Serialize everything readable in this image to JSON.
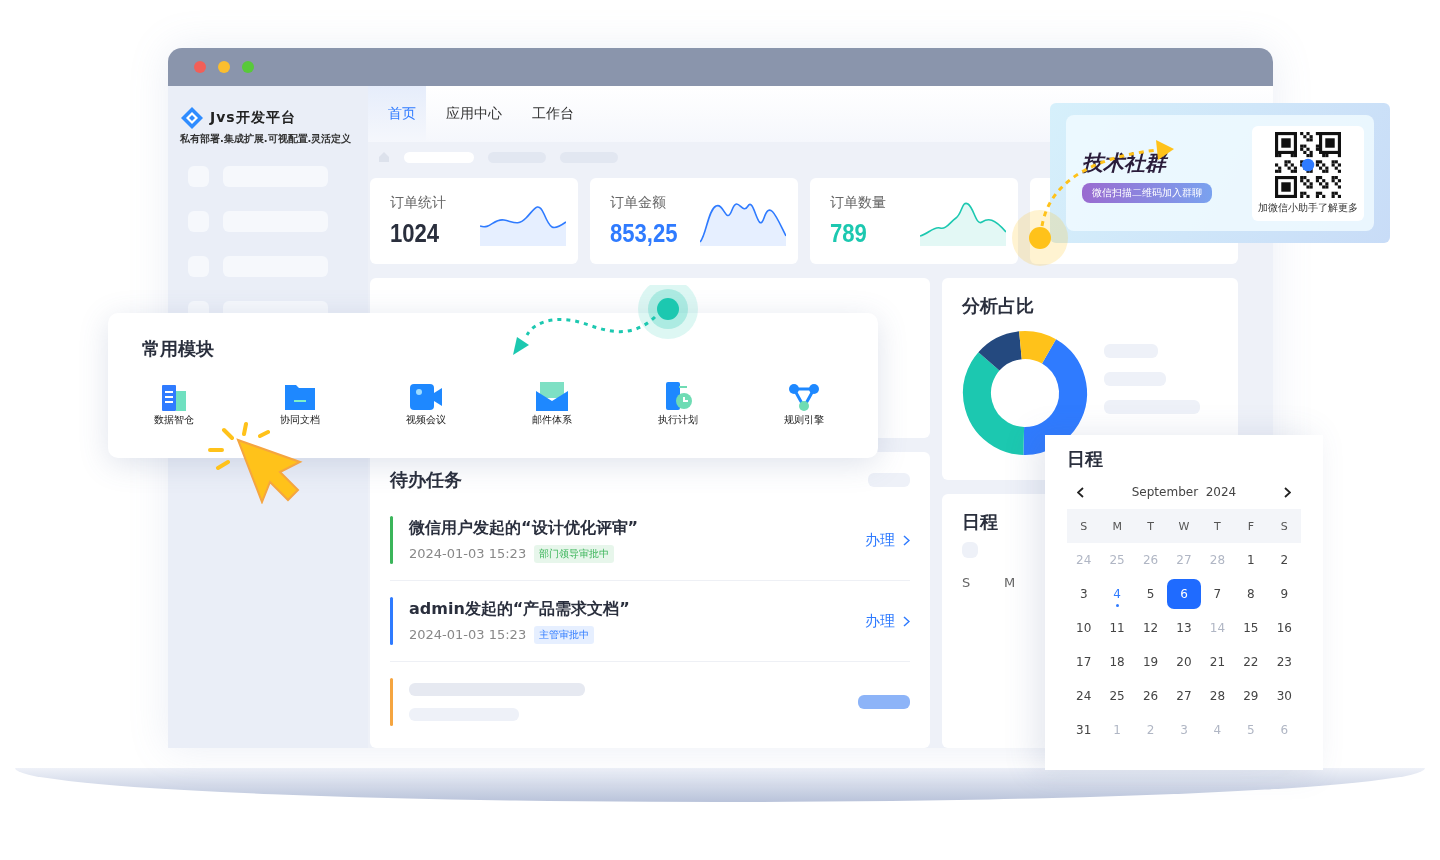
{
  "brand": {
    "name": "Jvs开发平台",
    "tagline": "私有部署.集成扩展.可视配置.灵活定义"
  },
  "nav_tabs": [
    {
      "label": "首页",
      "selected": true
    },
    {
      "label": "应用中心",
      "selected": false
    },
    {
      "label": "工作台",
      "selected": false
    }
  ],
  "stats": [
    {
      "label": "订单统计",
      "value": "1024",
      "color": "#2a2f3d"
    },
    {
      "label": "订单金额",
      "value": "853,25",
      "color": "#2f7bff"
    },
    {
      "label": "订单数量",
      "value": "789",
      "color": "#1cc8b0"
    }
  ],
  "modules": {
    "title": "常用模块",
    "items": [
      {
        "label": "数据智仓",
        "kind": "building"
      },
      {
        "label": "协同文档",
        "kind": "folder"
      },
      {
        "label": "视频会议",
        "kind": "video"
      },
      {
        "label": "邮件体系",
        "kind": "mail"
      },
      {
        "label": "执行计划",
        "kind": "clock"
      },
      {
        "label": "规则引擎",
        "kind": "share"
      }
    ]
  },
  "tasks": {
    "title": "待办任务",
    "items": [
      {
        "kind": "task",
        "title": "微信用户发起的“设计优化评审”",
        "time": "2024-01-03 15:23",
        "status": "部门领导审批中",
        "color": "#3bb55a",
        "action": "办理"
      },
      {
        "kind": "task",
        "title": "admin发起的“产品需求文档”",
        "time": "2024-01-03 15:23",
        "status": "主管审批中",
        "color": "#2f7bff",
        "action": "办理"
      },
      {
        "kind": "placeholder",
        "color": "#f5a540"
      }
    ]
  },
  "analysis": {
    "title": "分析占比"
  },
  "schedule_card": {
    "title": "日程",
    "weekdays": [
      "S",
      "M"
    ]
  },
  "community": {
    "title": "技术社群",
    "button": "微信扫描二维码加入群聊",
    "qr_caption": "加微信小助手了解更多"
  },
  "calendar": {
    "title": "日程",
    "month": "September  2024",
    "weekdays": [
      "S",
      "M",
      "T",
      "W",
      "T",
      "F",
      "S"
    ],
    "days": [
      {
        "label": "24",
        "muted": true,
        "selected": false,
        "event": false
      },
      {
        "label": "25",
        "muted": true,
        "selected": false,
        "event": false
      },
      {
        "label": "26",
        "muted": true,
        "selected": false,
        "event": false
      },
      {
        "label": "27",
        "muted": true,
        "selected": false,
        "event": false
      },
      {
        "label": "28",
        "muted": true,
        "selected": false,
        "event": false
      },
      {
        "label": "1",
        "muted": false,
        "selected": false,
        "event": false
      },
      {
        "label": "2",
        "muted": false,
        "selected": false,
        "event": false
      },
      {
        "label": "3",
        "muted": false,
        "selected": false,
        "event": false
      },
      {
        "label": "4",
        "muted": false,
        "selected": false,
        "event": true
      },
      {
        "label": "5",
        "muted": false,
        "selected": false,
        "event": false
      },
      {
        "label": "6",
        "muted": false,
        "selected": true,
        "event": false
      },
      {
        "label": "7",
        "muted": false,
        "selected": false,
        "event": false
      },
      {
        "label": "8",
        "muted": false,
        "selected": false,
        "event": false
      },
      {
        "label": "9",
        "muted": false,
        "selected": false,
        "event": false
      },
      {
        "label": "10",
        "muted": false,
        "selected": false,
        "event": false
      },
      {
        "label": "11",
        "muted": false,
        "selected": false,
        "event": false
      },
      {
        "label": "12",
        "muted": false,
        "selected": false,
        "event": false
      },
      {
        "label": "13",
        "muted": false,
        "selected": false,
        "event": false
      },
      {
        "label": "14",
        "muted": true,
        "selected": false,
        "event": false
      },
      {
        "label": "15",
        "muted": false,
        "selected": false,
        "event": false
      },
      {
        "label": "16",
        "muted": false,
        "selected": false,
        "event": false
      },
      {
        "label": "17",
        "muted": false,
        "selected": false,
        "event": false
      },
      {
        "label": "18",
        "muted": false,
        "selected": false,
        "event": false
      },
      {
        "label": "19",
        "muted": false,
        "selected": false,
        "event": false
      },
      {
        "label": "20",
        "muted": false,
        "selected": false,
        "event": false
      },
      {
        "label": "21",
        "muted": false,
        "selected": false,
        "event": false
      },
      {
        "label": "22",
        "muted": false,
        "selected": false,
        "event": false
      },
      {
        "label": "23",
        "muted": false,
        "selected": false,
        "event": false
      },
      {
        "label": "24",
        "muted": false,
        "selected": false,
        "event": false
      },
      {
        "label": "25",
        "muted": false,
        "selected": false,
        "event": false
      },
      {
        "label": "26",
        "muted": false,
        "selected": false,
        "event": false
      },
      {
        "label": "27",
        "muted": false,
        "selected": false,
        "event": false
      },
      {
        "label": "28",
        "muted": false,
        "selected": false,
        "event": false
      },
      {
        "label": "29",
        "muted": false,
        "selected": false,
        "event": false
      },
      {
        "label": "30",
        "muted": false,
        "selected": false,
        "event": false
      },
      {
        "label": "31",
        "muted": false,
        "selected": false,
        "event": false
      },
      {
        "label": "1",
        "muted": true,
        "selected": false,
        "event": false
      },
      {
        "label": "2",
        "muted": true,
        "selected": false,
        "event": false
      },
      {
        "label": "3",
        "muted": true,
        "selected": false,
        "event": false
      },
      {
        "label": "4",
        "muted": true,
        "selected": false,
        "event": false
      },
      {
        "label": "5",
        "muted": true,
        "selected": false,
        "event": false
      },
      {
        "label": "6",
        "muted": true,
        "selected": false,
        "event": false
      }
    ]
  }
}
